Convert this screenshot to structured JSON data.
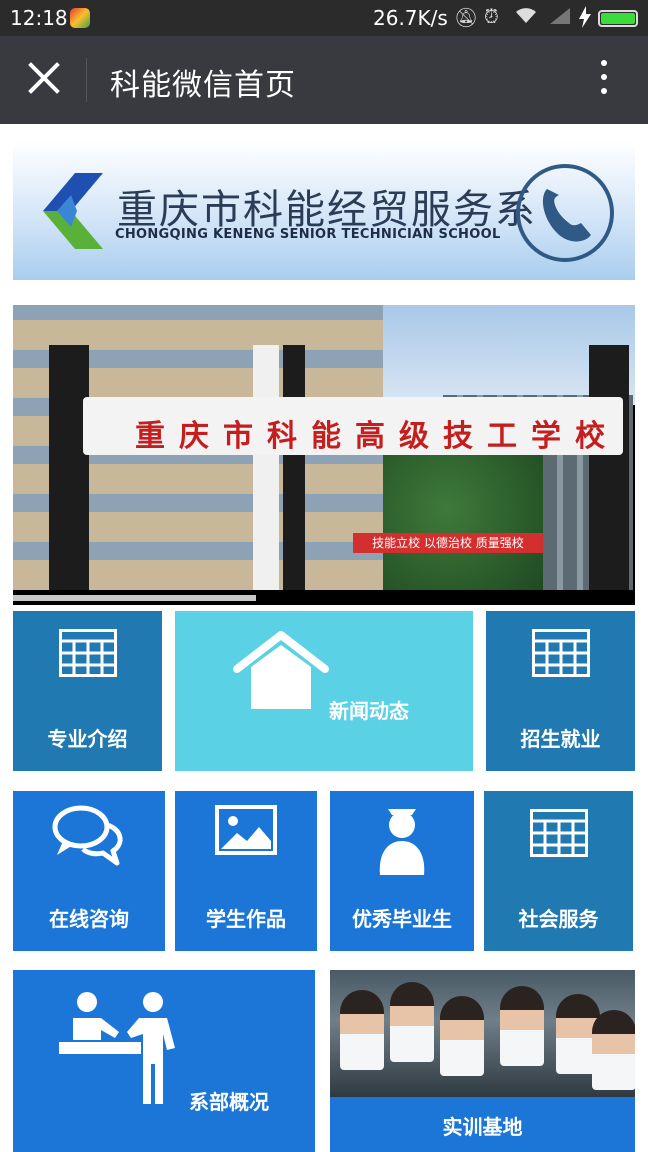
{
  "status_bar": {
    "time": "12:18",
    "network_speed": "26.7K/s",
    "icons": [
      "mute-icon",
      "alarm-icon",
      "wifi-icon",
      "signal-icon",
      "charging-icon",
      "battery-icon"
    ]
  },
  "title_bar": {
    "title": "科能微信首页",
    "close_icon": "close-icon",
    "more_icon": "more-vertical-icon"
  },
  "banner": {
    "title_cn": "重庆市科能经贸服务系",
    "title_en": "CHONGQING KENENG SENIOR TECHNICIAN SCHOOL"
  },
  "carousel": {
    "gate_text": "重庆市科能高级技工学校",
    "slogan": "技能立校  以德治校  质量强校",
    "progress_fraction": 0.39
  },
  "tiles": {
    "major_intro": "专业介绍",
    "news": "新闻动态",
    "enrollment": "招生就业",
    "consult": "在线咨询",
    "works": "学生作品",
    "graduates": "优秀毕业生",
    "social": "社会服务",
    "department": "系部概况",
    "training": "实训基地"
  },
  "colors": {
    "teal_tile": "#2079b0",
    "blue_tile": "#1b76d8",
    "cyan_tile": "#5ad1e4",
    "title_bar": "#383a3f"
  }
}
